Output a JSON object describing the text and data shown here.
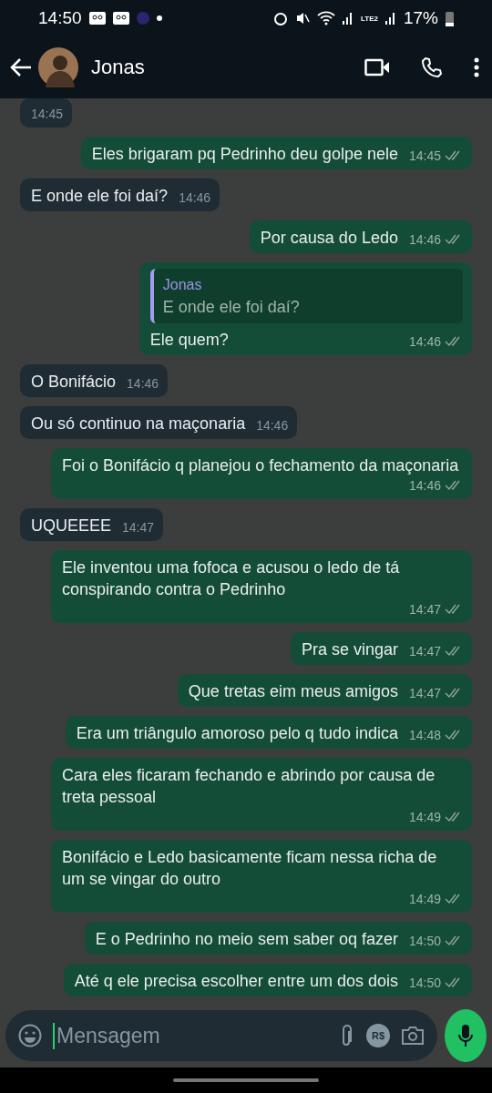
{
  "status_bar": {
    "time": "14:50",
    "network": "LTE2",
    "battery": "17%"
  },
  "header": {
    "contact": "Jonas"
  },
  "messages": [
    {
      "kind": "in",
      "time": "14:45"
    },
    {
      "kind": "out",
      "text": "Eles brigaram pq Pedrinho deu golpe nele",
      "time": "14:45"
    },
    {
      "kind": "in",
      "text": "E onde ele foi daí?",
      "time": "14:46"
    },
    {
      "kind": "out",
      "text": "Por causa do Ledo",
      "time": "14:46"
    },
    {
      "kind": "out",
      "text": "Ele quem?",
      "time": "14:46",
      "reply": {
        "author": "Jonas",
        "text": "E onde ele foi daí?"
      }
    },
    {
      "kind": "in",
      "text": "O Bonifácio",
      "time": "14:46"
    },
    {
      "kind": "in",
      "text": "Ou só continuo na maçonaria",
      "time": "14:46"
    },
    {
      "kind": "out",
      "text": "Foi o Bonifácio q planejou o fechamento da maçonaria",
      "time": "14:46"
    },
    {
      "kind": "in",
      "text": "UQUEEEE",
      "time": "14:47"
    },
    {
      "kind": "out",
      "text": "Ele inventou uma fofoca e acusou o ledo de tá conspirando contra o Pedrinho",
      "time": "14:47"
    },
    {
      "kind": "out",
      "text": "Pra se vingar",
      "time": "14:47"
    },
    {
      "kind": "out",
      "text": "Que tretas eim meus amigos",
      "time": "14:47"
    },
    {
      "kind": "out",
      "text": "Era um triângulo amoroso pelo q tudo indica",
      "time": "14:48"
    },
    {
      "kind": "out",
      "text": "Cara eles ficaram fechando e abrindo por causa de treta pessoal",
      "time": "14:49"
    },
    {
      "kind": "out",
      "text": "Bonifácio e Ledo basicamente ficam nessa richa de um se vingar do outro",
      "time": "14:49"
    },
    {
      "kind": "out",
      "text": "E o Pedrinho no meio sem saber oq fazer",
      "time": "14:50"
    },
    {
      "kind": "out",
      "text": "Até q ele precisa escolher entre um dos dois",
      "time": "14:50"
    }
  ],
  "composer": {
    "placeholder": "Mensagem",
    "currency": "R$"
  }
}
